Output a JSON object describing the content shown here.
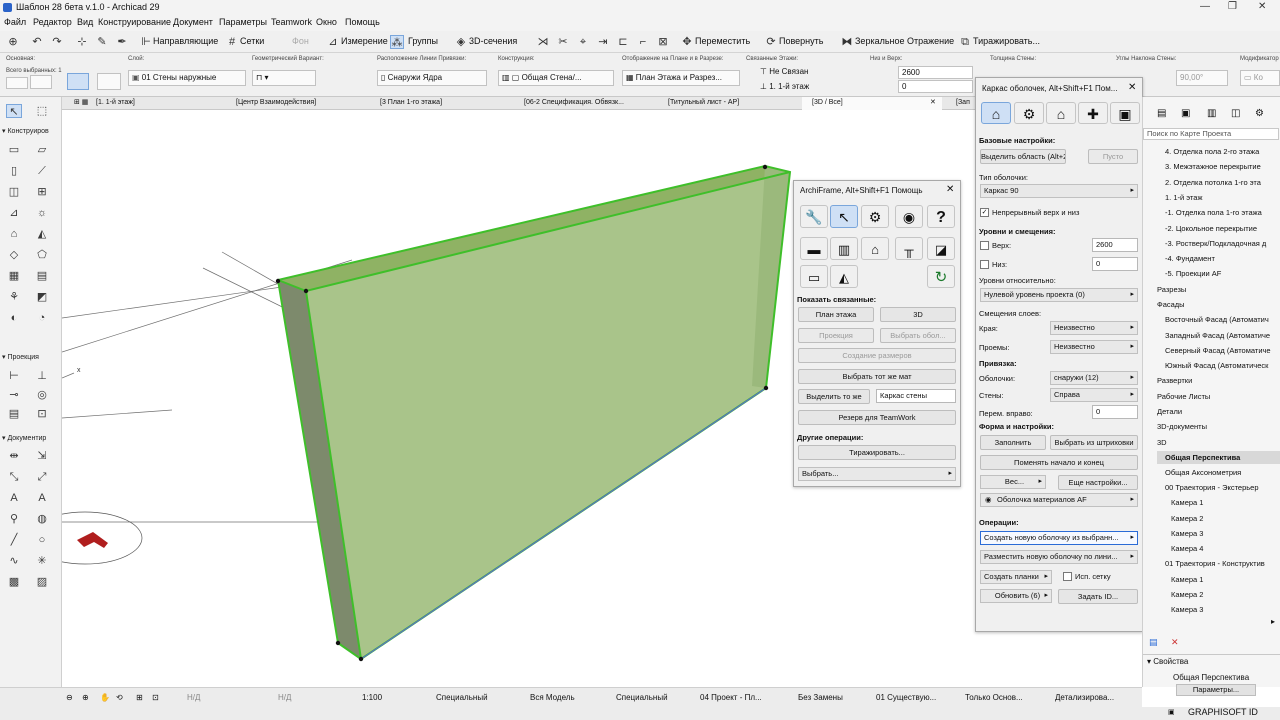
{
  "window": {
    "title": "Шаблон 28 бета v.1.0 - Archicad 29"
  },
  "menu": [
    "Файл",
    "Редактор",
    "Вид",
    "Конструирование",
    "Документ",
    "Параметры",
    "Teamwork",
    "Окно",
    "Помощь"
  ],
  "toolbar": {
    "guides": "Направляющие",
    "grids": "Сетки",
    "bg": "Фон",
    "measure": "Измерение",
    "groups": "Группы",
    "sections3d": "3D-сечения",
    "move": "Переместить",
    "rotate": "Повернуть",
    "mirror": "Зеркальное Отражение",
    "multiply": "Тиражировать..."
  },
  "infobox": {
    "main_caption": "Основная:",
    "selected": "Всего выбранных: 1",
    "layer_caption": "Слой:",
    "layer_value": "01 Стены наружные",
    "geom_caption": "Геометрический Вариант:",
    "refline_caption": "Расположение Линии Привязки:",
    "refline_value": "Снаружи Ядра",
    "construct_caption": "Конструкция:",
    "construct_value": "Общая Стена/...",
    "display_caption": "Отображение на Плане и в Разрезе:",
    "display_value": "План Этажа и Разрез...",
    "stories_caption": "Связанные Этажи:",
    "story_top": "Не Связан",
    "story_bottom": "1. 1-й этаж",
    "height_caption": "Низ и Верх:",
    "height_top": "2600",
    "height_bottom": "0",
    "thick_caption": "Толщина Стены:",
    "slant_caption": "Углы Наклона Стены:",
    "slant_value": "90,00°",
    "mod_caption": "Модификатор"
  },
  "tabs": [
    "[1. 1-й этаж]",
    "[Центр Взаимодействия]",
    "[3 План 1-го этажа]",
    "[06-2 Спецификация. Обвязк...",
    "[Титульный лист - АР]",
    "[3D / Все]",
    "[Зап"
  ],
  "toolbox": {
    "sec1": "Конструиров",
    "sec2": "Проекция",
    "sec3": "Документир"
  },
  "archiframe": {
    "title": "ArchiFrame, Alt+Shift+F1 Помощь",
    "show_linked": "Показать связанные:",
    "plan": "План этажа",
    "3d": "3D",
    "projection": "Проекция",
    "select_shell": "Выбрать обол...",
    "create_dims": "Создание размеров",
    "select_same_mat": "Выбрать тот же мат",
    "select_same": "Выделить то же",
    "select_same_value": "Каркас стены",
    "teamwork": "Резерв для TeamWork",
    "other_ops": "Другие операции:",
    "multiply": "Тиражировать...",
    "choose": "Выбрать..."
  },
  "shell": {
    "title": "Каркас оболочек, Alt+Shift+F1 Пом...",
    "basic": "Базовые настройки:",
    "select_area": "Выделить область (Alt+2)",
    "empty": "Пусто",
    "type_caption": "Тип оболочки:",
    "type_value": "Каркас 90",
    "continuous": "Непрерывный верх и низ",
    "levels": "Уровни и смещения:",
    "top": "Верх:",
    "top_value": "2600",
    "bottom": "Низ:",
    "bottom_value": "0",
    "relative": "Уровни относительно:",
    "relative_value": "Нулевой уровень проекта (0)",
    "layer_offsets": "Смещения слоев:",
    "edges": "Края:",
    "edges_value": "Неизвестно",
    "openings": "Проемы:",
    "openings_value": "Неизвестно",
    "binding": "Привязка:",
    "shells": "Оболочки:",
    "shells_value": "снаружи (12)",
    "walls": "Стены:",
    "walls_value": "Справа",
    "shift_right": "Перем. вправо:",
    "shift_value": "0",
    "form": "Форма и настройки:",
    "fill": "Заполнить",
    "select_hatch": "Выбрать из штриховки",
    "swap": "Поменять начало и конец",
    "weight": "Вес...",
    "more": "Еще настройки...",
    "material": "Оболочка материалов AF",
    "operations": "Операции:",
    "create_new": "Создать новую оболочку из выбранн...",
    "place_new": "Разместить новую оболочку по лини...",
    "create_boards": "Создать планки",
    "use_grid": "Исп. сетку",
    "update": "Обновить (6)",
    "set_id": "Задать ID..."
  },
  "navigator": {
    "search": "Поиск по Карте Проекта",
    "items": [
      "4. Отделка пола 2-го этажа",
      "3. Межэтажное перекрытие",
      "2. Отделка потолка 1-го эта",
      "1. 1-й этаж",
      "-1. Отделка пола 1-го этажа",
      "-2. Цокольное перекрытие",
      "-3. Ростверк/Подкладочная д",
      "-4. Фундамент",
      "-5. Проекции AF",
      "Разрезы",
      "Фасады",
      "Восточный Фасад (Автоматич",
      "Западный Фасад (Автоматиче",
      "Северный Фасад (Автоматиче",
      "Южный Фасад (Автоматическ",
      "Развертки",
      "Рабочие Листы",
      "Детали",
      "3D-документы",
      "3D",
      "Общая Перспектива",
      "Общая Аксонометрия",
      "00 Траектория - Экстерьер",
      "Камера 1",
      "Камера 2",
      "Камера 3",
      "Камера 4",
      "01 Траектория - Конструктив",
      "Камера 1",
      "Камера 2",
      "Камера 3"
    ],
    "props_caption": "Свойства",
    "props_value": "Общая Перспектива",
    "params": "Параметры...",
    "brand": "GRAPHISOFT ID"
  },
  "status": {
    "nd1": "Н/Д",
    "nd2": "Н/Д",
    "scale": "1:100",
    "special1": "Специальный",
    "model": "Вся Модель",
    "special2": "Специальный",
    "project": "04 Проект - Пл...",
    "nosub": "Без Замены",
    "existing": "01 Существую...",
    "onlybase": "Только Основ...",
    "detail": "Детализирова..."
  },
  "colors": {
    "wall_fill": "#a9c48a",
    "wall_edge": "#3fbf2a",
    "accent": "#2a6bd6"
  }
}
